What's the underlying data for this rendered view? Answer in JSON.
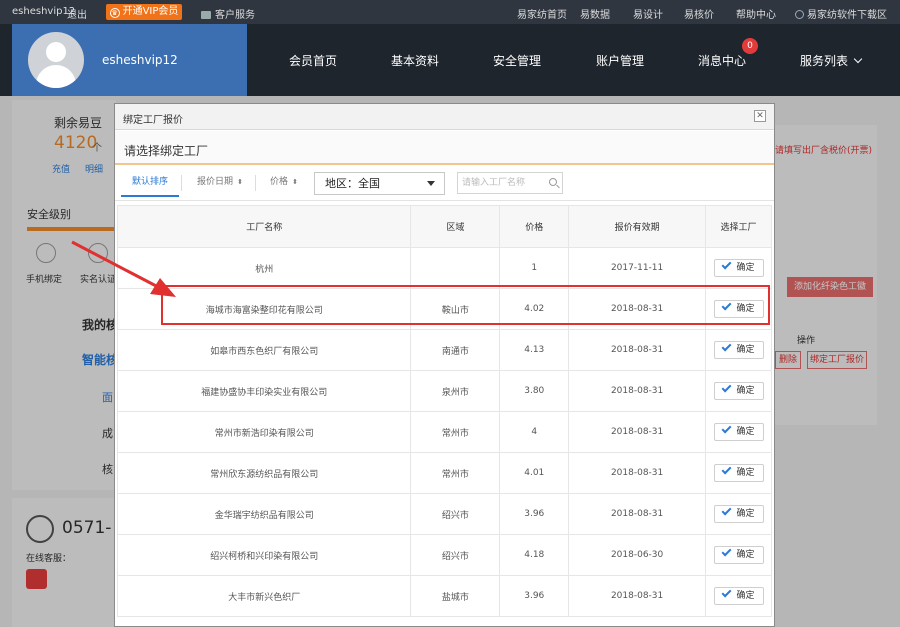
{
  "topbar": {
    "username": "esheshvip12",
    "logout": "退出",
    "vip": "开通VIP会员",
    "vip_icon": "crown-icon",
    "customer_service": "客户服务",
    "links": [
      "易家纺首页",
      "易数据",
      "易设计",
      "易核价",
      "帮助中心"
    ],
    "download": "易家纺软件下载区"
  },
  "header": {
    "username": "esheshvip12",
    "nav": [
      "会员首页",
      "基本资料",
      "安全管理",
      "账户管理",
      "消息中心",
      "服务列表"
    ],
    "message_badge": "0"
  },
  "background": {
    "beans_label": "剩余易豆",
    "beans_value": "4120",
    "beans_unit": "个",
    "recharge": "充值",
    "detail": "明细",
    "security_level": "安全级别",
    "phone_bind": "手机绑定",
    "realname": "实名认证",
    "my_check": "我的核",
    "smart_check": "智能核",
    "sub_items": [
      "面",
      "成",
      "核"
    ],
    "phone": "0571-",
    "online_service": "在线客服：",
    "right_note": "请填写出厂含税价(开票)",
    "add_button": "添加化纤染色工徽",
    "ops_header": "操作",
    "delete": "删除",
    "bind_quote": "绑定工厂报价"
  },
  "modal": {
    "title": "绑定工厂报价",
    "subtitle": "请选择绑定工厂",
    "tabs": [
      "默认排序",
      "报价日期",
      "价格"
    ],
    "region_label": "地区：全国",
    "search_placeholder": "请输入工厂名称",
    "columns": [
      "工厂名称",
      "区域",
      "价格",
      "报价有效期",
      "选择工厂"
    ],
    "confirm_label": "确定",
    "rows": [
      {
        "name": "杭州",
        "region": "",
        "price": "1",
        "date": "2017-11-11"
      },
      {
        "name": "海城市海富染整印花有限公司",
        "region": "鞍山市",
        "price": "4.02",
        "date": "2018-08-31"
      },
      {
        "name": "如皋市西东色织厂有限公司",
        "region": "南通市",
        "price": "4.13",
        "date": "2018-08-31"
      },
      {
        "name": "福建协盛协丰印染实业有限公司",
        "region": "泉州市",
        "price": "3.80",
        "date": "2018-08-31"
      },
      {
        "name": "常州市新浩印染有限公司",
        "region": "常州市",
        "price": "4",
        "date": "2018-08-31"
      },
      {
        "name": "常州欣东源纺织品有限公司",
        "region": "常州市",
        "price": "4.01",
        "date": "2018-08-31"
      },
      {
        "name": "金华瑞宇纺织品有限公司",
        "region": "绍兴市",
        "price": "3.96",
        "date": "2018-08-31"
      },
      {
        "name": "绍兴柯桥和兴印染有限公司",
        "region": "绍兴市",
        "price": "4.18",
        "date": "2018-06-30"
      },
      {
        "name": "大丰市新兴色织厂",
        "region": "盐城市",
        "price": "3.96",
        "date": "2018-08-31"
      }
    ]
  },
  "colors": {
    "accent": "#2b7bd6",
    "vip": "#f0731a",
    "annotation": "#e03030",
    "header": "#1f252d"
  }
}
